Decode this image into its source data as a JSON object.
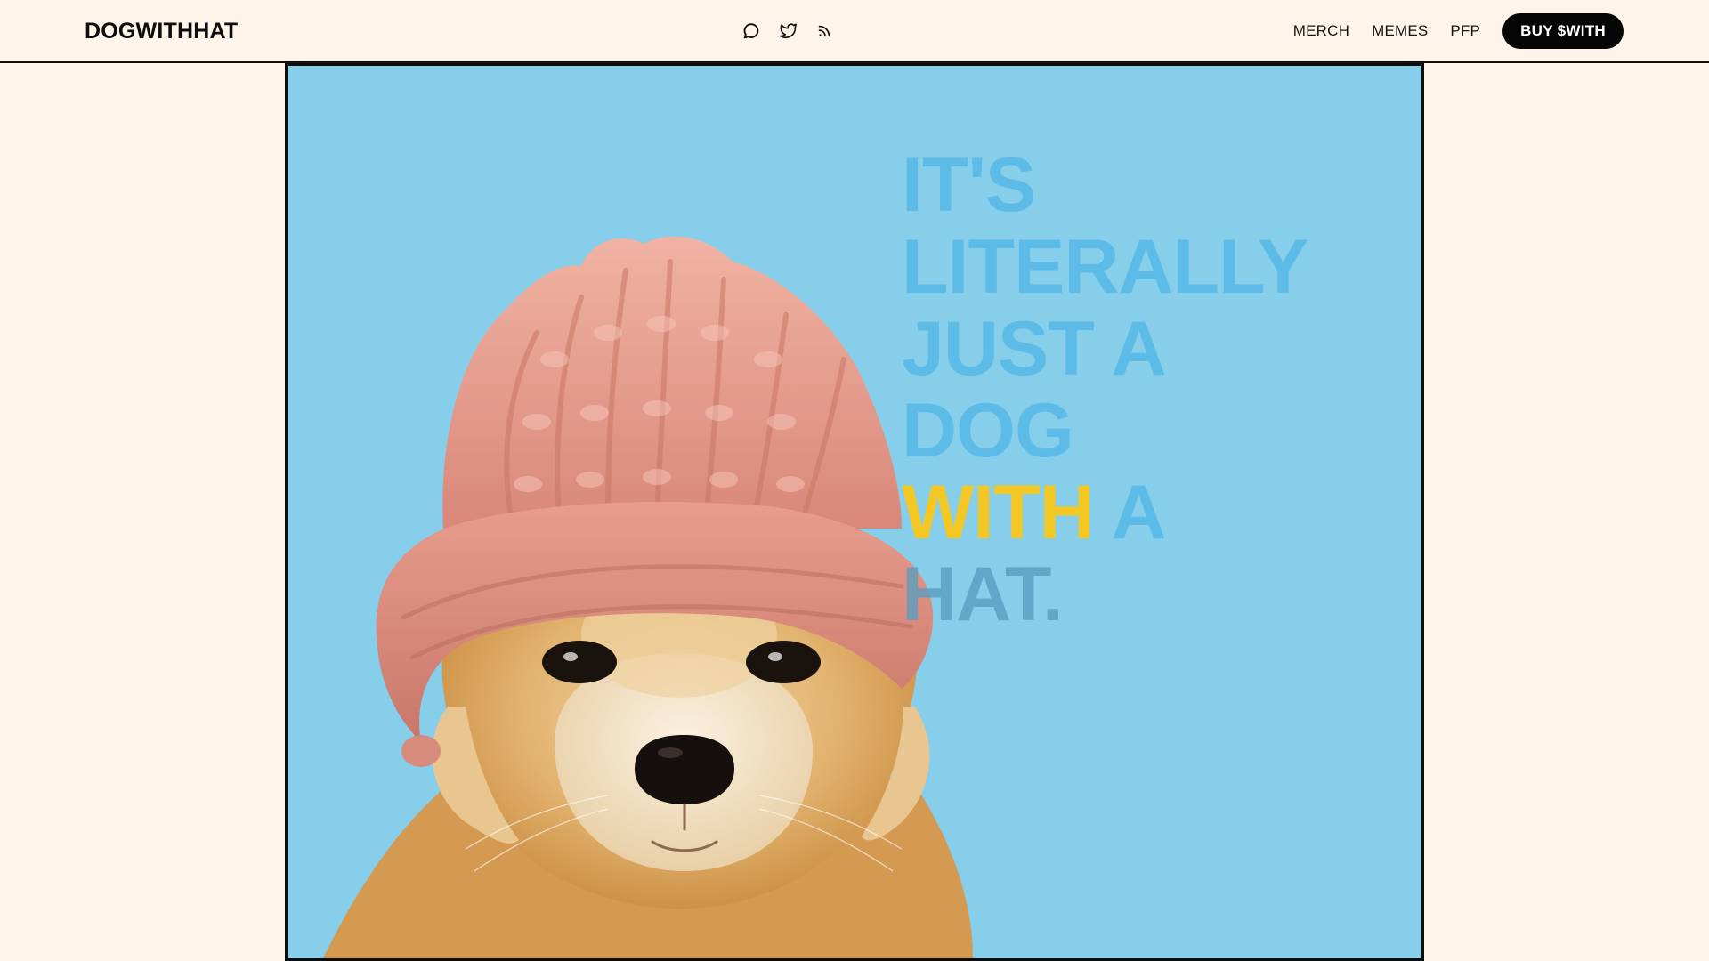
{
  "header": {
    "brand": "DOGWITHHAT",
    "icons": [
      "chat-icon",
      "twitter-icon",
      "rss-icon"
    ],
    "nav": {
      "merch": "MERCH",
      "memes": "MEMES",
      "pfp": "PFP"
    },
    "buy_label": "BUY $WITH"
  },
  "hero": {
    "line1": "IT'S",
    "line2": "LITERALLY",
    "line3": "JUST A",
    "line4": "DOG",
    "line5_highlight": "WITH",
    "line5_rest": " A",
    "line6": "HAT."
  },
  "colors": {
    "page_bg": "#fff4ea",
    "hero_bg": "#87ceea",
    "headline": "#5bbbe8",
    "highlight": "#fac81a",
    "button_bg": "#050505"
  }
}
